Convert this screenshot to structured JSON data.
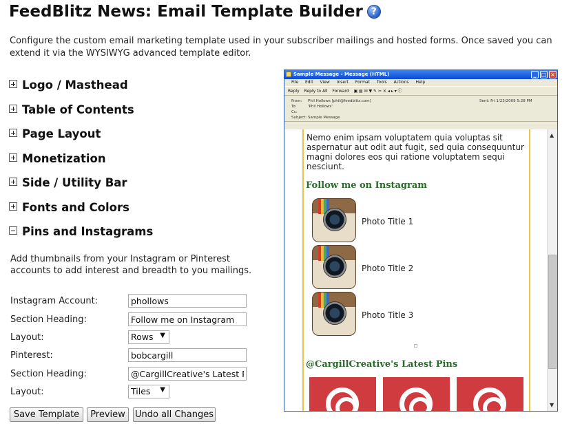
{
  "page": {
    "title": "FeedBlitz News: Email Template Builder",
    "help_icon": "question-help-icon",
    "intro": "Configure the custom email marketing template used in your subscriber mailings and hosted forms. Once saved you can extend it via the WYSIWYG advanced template editor."
  },
  "sections": [
    {
      "label": "Logo / Masthead",
      "state": "collapsed"
    },
    {
      "label": "Table of Contents",
      "state": "collapsed"
    },
    {
      "label": "Page Layout",
      "state": "collapsed"
    },
    {
      "label": "Monetization",
      "state": "collapsed"
    },
    {
      "label": "Side / Utility Bar",
      "state": "collapsed"
    },
    {
      "label": "Fonts and Colors",
      "state": "collapsed"
    },
    {
      "label": "Pins and Instagrams",
      "state": "expanded"
    }
  ],
  "pins": {
    "description": "Add thumbnails from your Instagram or Pinterest accounts to add interest and breadth to you mailings.",
    "fields": {
      "instagram_account": {
        "label": "Instagram Account:",
        "value": "phollows"
      },
      "insta_heading": {
        "label": "Section Heading:",
        "value": "Follow me on Instagram"
      },
      "insta_layout": {
        "label": "Layout:",
        "value": "Rows"
      },
      "pinterest": {
        "label": "Pinterest:",
        "value": "bobcargill"
      },
      "pin_heading": {
        "label": "Section Heading:",
        "value": "@CargillCreative's Latest Pins"
      },
      "pin_layout": {
        "label": "Layout:",
        "value": "Tiles"
      }
    }
  },
  "buttons": {
    "save": "Save Template",
    "preview": "Preview",
    "undo": "Undo all Changes"
  },
  "preview_window": {
    "title": "Sample Message - Message (HTML)",
    "menu": [
      "File",
      "Edit",
      "View",
      "Insert",
      "Format",
      "Tools",
      "Actions",
      "Help"
    ],
    "toolbar": [
      "Reply",
      "Reply to All",
      "Forward"
    ],
    "header": {
      "from_label": "From:",
      "from": "Phil Hollows [phil@feedblitz.com]",
      "to_label": "To:",
      "to": "'Phil Hollows'",
      "cc_label": "Cc:",
      "cc": "",
      "subject_label": "Subject:",
      "subject": "Sample Message",
      "sent_label": "Sent:",
      "sent": "Fri 1/23/2009 5:28 PM"
    },
    "body": {
      "lorem": "Nemo enim ipsam voluptatem quia voluptas sit aspernatur aut odit aut fugit, sed quia consequuntur magni dolores eos qui ratione voluptatem sequi nesciunt.",
      "insta_heading": "Follow me on Instagram",
      "photos": [
        "Photo Title 1",
        "Photo Title 2",
        "Photo Title 3"
      ],
      "pins_heading": "@CargillCreative's Latest Pins"
    }
  }
}
